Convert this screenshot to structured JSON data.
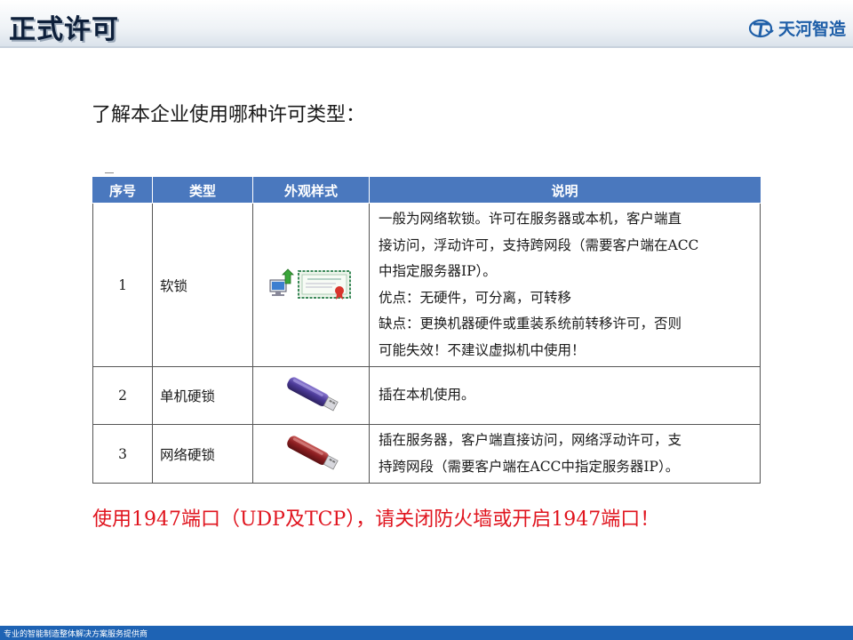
{
  "header": {
    "title": "正式许可",
    "logo_text": "天河智造"
  },
  "intro": "了解本企业使用哪种许可类型：",
  "table": {
    "headers": [
      "序号",
      "类型",
      "外观样式",
      "说明"
    ],
    "rows": [
      {
        "no": "1",
        "type": "软锁",
        "icon": "soft-license-certificate-icon",
        "desc": [
          "一般为网络软锁。许可在服务器或本机，客户端直",
          "接访问，浮动许可，支持跨网段（需要客户端在ACC",
          "中指定服务器IP）。",
          "优点：无硬件，可分离，可转移",
          "缺点：更换机器硬件或重装系统前转移许可，否则",
          "可能失效！不建议虚拟机中使用！"
        ]
      },
      {
        "no": "2",
        "type": "单机硬锁",
        "icon": "purple-usb-dongle-icon",
        "desc": [
          "插在本机使用。"
        ]
      },
      {
        "no": "3",
        "type": "网络硬锁",
        "icon": "red-usb-dongle-icon",
        "desc": [
          "插在服务器，客户端直接访问，网络浮动许可，支",
          "持跨网段（需要客户端在ACC中指定服务器IP）。"
        ]
      }
    ]
  },
  "port_note": "使用1947端口（UDP及TCP），请关闭防火墙或开启1947端口！",
  "footer": "专业的智能制造整体解决方案服务提供商",
  "colors": {
    "table_header": "#4a78be",
    "note_red": "#e0141e",
    "footer_blue": "#1e63b4",
    "logo_blue": "#1f5fa8"
  }
}
